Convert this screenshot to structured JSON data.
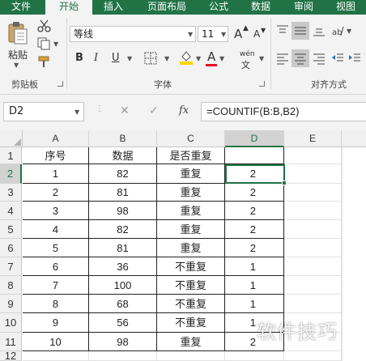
{
  "tabs": [
    "文件",
    "开始",
    "插入",
    "页面布局",
    "公式",
    "数据",
    "审阅",
    "视图"
  ],
  "ribbon": {
    "paste_label": "粘贴",
    "clipboard_group": "剪贴板",
    "font_group": "字体",
    "align_group": "对齐方式",
    "font_name": "等线",
    "font_size": "11",
    "bold": "B",
    "italic": "I",
    "underline": "U",
    "grow_font": "A",
    "shrink_font": "A",
    "phonetic_glyph": "wén",
    "font_color_glyph": "A",
    "accent_red": "#e81123",
    "accent_yellow": "#ffd700",
    "brand_green": "#217346"
  },
  "formula_bar": {
    "name_box": "D2",
    "cancel": "✕",
    "enter": "✓",
    "fx": "fx",
    "formula": "=COUNTIF(B:B,B2)"
  },
  "sheet": {
    "columns": [
      "A",
      "B",
      "C",
      "D",
      "E"
    ],
    "rows": [
      "1",
      "2",
      "3",
      "4",
      "5",
      "6",
      "7",
      "8",
      "9",
      "10",
      "11",
      "12"
    ],
    "header": [
      "序号",
      "数据",
      "是否重复",
      ""
    ],
    "data": [
      [
        "1",
        "82",
        "重复",
        "2"
      ],
      [
        "2",
        "81",
        "重复",
        "2"
      ],
      [
        "3",
        "98",
        "重复",
        "2"
      ],
      [
        "4",
        "82",
        "重复",
        "2"
      ],
      [
        "5",
        "81",
        "重复",
        "2"
      ],
      [
        "6",
        "36",
        "不重复",
        "1"
      ],
      [
        "7",
        "100",
        "不重复",
        "1"
      ],
      [
        "8",
        "68",
        "不重复",
        "1"
      ],
      [
        "9",
        "56",
        "不重复",
        "1"
      ],
      [
        "10",
        "98",
        "重复",
        "2"
      ]
    ]
  },
  "watermark": "软件技巧"
}
